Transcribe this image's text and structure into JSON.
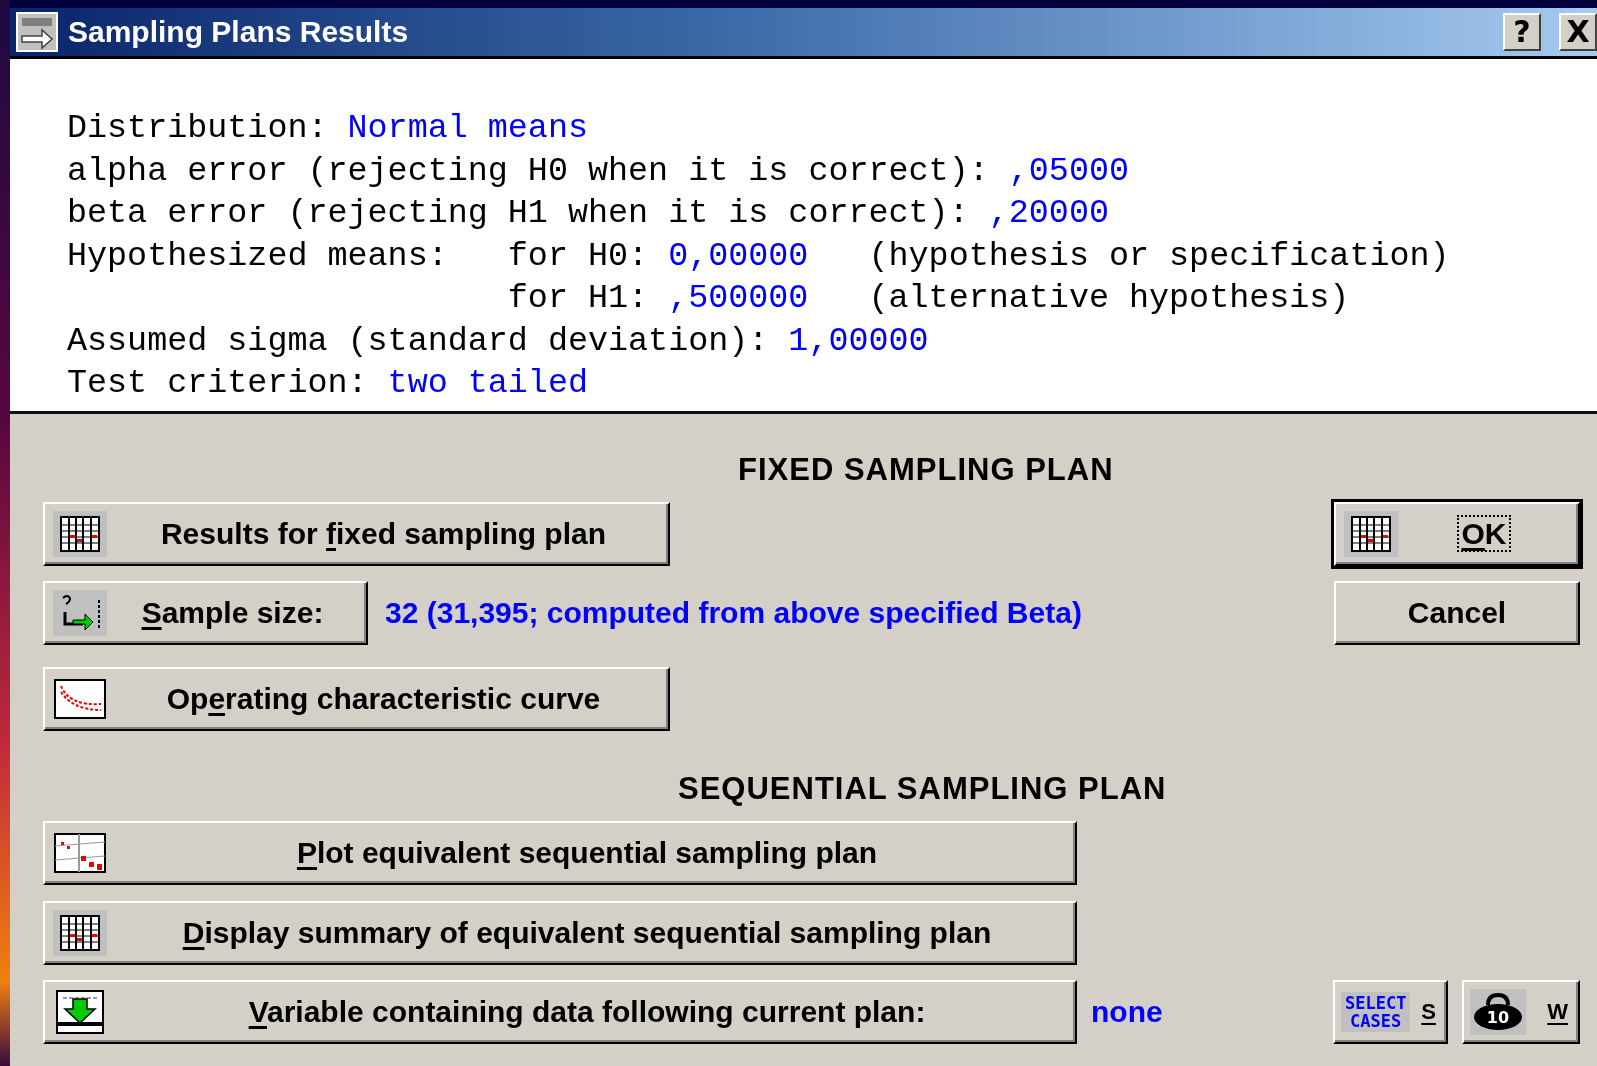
{
  "window": {
    "title": "Sampling Plans Results",
    "controls": [
      {
        "kind": "help",
        "glyph": "?"
      },
      {
        "kind": "close",
        "glyph": "X"
      }
    ]
  },
  "report": {
    "blocks": [
      {
        "kind": "line",
        "segments": [
          {
            "kind": "label",
            "text": "Distribution: "
          },
          {
            "kind": "value",
            "text": "Normal means"
          }
        ]
      },
      {
        "kind": "line",
        "segments": [
          {
            "kind": "label",
            "text": "alpha error (rejecting H0 when it is correct): "
          },
          {
            "kind": "value",
            "text": ",05000"
          }
        ]
      },
      {
        "kind": "line",
        "segments": [
          {
            "kind": "label",
            "text": "beta error (rejecting H1 when it is correct): "
          },
          {
            "kind": "value",
            "text": ",20000"
          }
        ]
      },
      {
        "kind": "table",
        "label": "Hypothesized means:",
        "rows": [
          {
            "name": "for H0:",
            "value": "0,00000",
            "note": "(hypothesis or specification)"
          },
          {
            "name": "for H1:",
            "value": ",500000",
            "note": "(alternative hypothesis)"
          }
        ]
      },
      {
        "kind": "line",
        "segments": [
          {
            "kind": "label",
            "text": "Assumed sigma (standard deviation): "
          },
          {
            "kind": "value",
            "text": "1,00000"
          }
        ]
      },
      {
        "kind": "line",
        "segments": [
          {
            "kind": "label",
            "text": "Test criterion: "
          },
          {
            "kind": "value",
            "text": "two tailed"
          }
        ]
      }
    ]
  },
  "fixed_plan": {
    "title": "FIXED SAMPLING PLAN",
    "buttons": [
      {
        "kind": "table",
        "pre": "Results for ",
        "key": "f",
        "post": "ixed sampling plan"
      },
      {
        "kind": "sample-size",
        "key": "S",
        "post": "ample size:",
        "result": "32 (31,395; computed from above specified Beta)"
      },
      {
        "kind": "curve",
        "pre": "Op",
        "key": "e",
        "post": "rating characteristic curve"
      }
    ]
  },
  "dialog_buttons": [
    {
      "kind": "ok",
      "key": "O",
      "post": "K",
      "default": true,
      "focused": true
    },
    {
      "kind": "cancel",
      "pre": "Cancel",
      "default": false,
      "focused": false
    }
  ],
  "sequential_plan": {
    "title": "SEQUENTIAL SAMPLING PLAN",
    "buttons": [
      {
        "kind": "sequence-plot",
        "key": "P",
        "post": "lot equivalent sequential sampling plan"
      },
      {
        "kind": "table",
        "key": "D",
        "post": "isplay summary of equivalent sequential sampling plan"
      },
      {
        "kind": "variable",
        "key": "V",
        "post": "ariable containing data following current plan:",
        "result": "none"
      }
    ]
  },
  "tools": [
    {
      "kind": "select-cases",
      "badge": [
        "SELECT",
        "CASES"
      ],
      "key": "S"
    },
    {
      "kind": "weight",
      "badge": [
        "10"
      ],
      "key": "W"
    }
  ]
}
